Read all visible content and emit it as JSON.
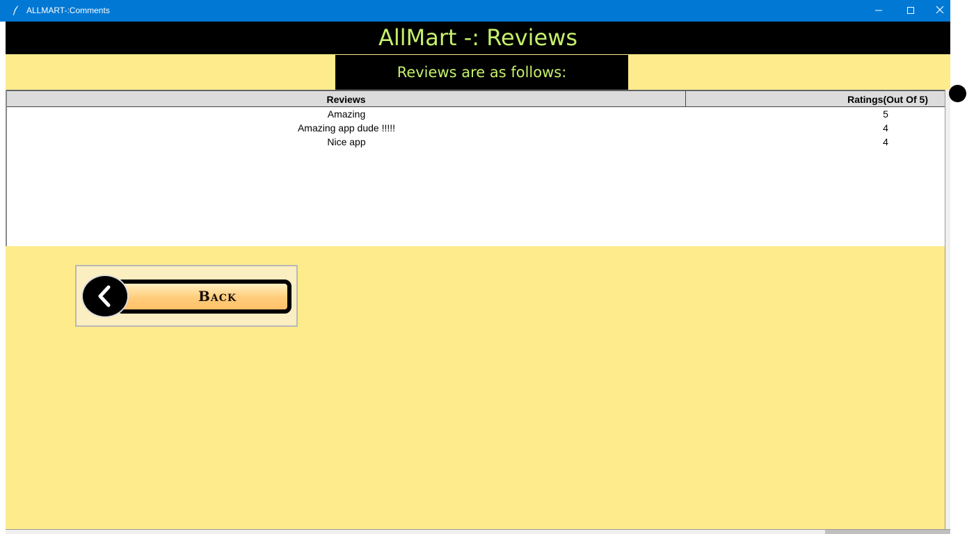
{
  "window": {
    "title": "ALLMART-:Comments",
    "controls": [
      "minimize-icon",
      "maximize-icon",
      "close-icon"
    ]
  },
  "app": {
    "header_title": "AllMart -: Reviews",
    "subheader": "Reviews are as follows:"
  },
  "table": {
    "columns": [
      "Reviews",
      "Ratings(Out Of 5)"
    ],
    "rows": [
      {
        "review": "Amazing",
        "rating": "5"
      },
      {
        "review": "Amazing app dude !!!!!",
        "rating": "4"
      },
      {
        "review": "Nice app",
        "rating": "4"
      }
    ]
  },
  "back_button": {
    "label": "Back",
    "icon": "chevron-left-icon"
  },
  "colors": {
    "title_bar": "#0078d4",
    "header_bg": "#000000",
    "header_text": "#c5f06b",
    "page_bg": "#feeb8c"
  }
}
